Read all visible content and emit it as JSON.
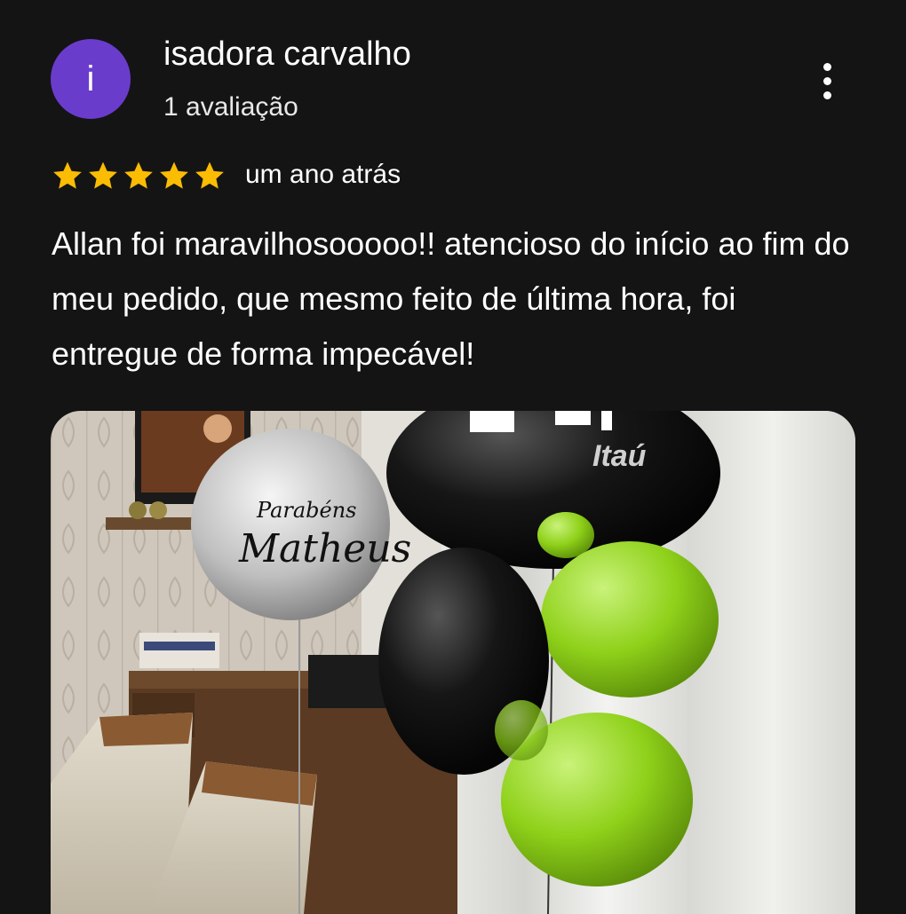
{
  "reviewer": {
    "avatar_letter": "i",
    "name": "isadora carvalho",
    "review_count": "1 avaliação"
  },
  "review": {
    "rating": 5,
    "max_rating": 5,
    "time_ago": "um ano atrás",
    "text": "Allan foi maravilhosooooo!! atencioso do início ao fim do meu pedido, que mesmo feito de última hora, foi entregue de forma impecável!"
  },
  "photo": {
    "balloon_text_line1": "Parabéns",
    "balloon_text_line2": "Matheus",
    "brand_text": "Itaú"
  },
  "colors": {
    "background": "#141414",
    "avatar": "#6a3ccc",
    "star": "#fbbc04",
    "text": "#ffffff"
  },
  "icons": {
    "more": "more-vert-icon",
    "star": "star-icon"
  }
}
